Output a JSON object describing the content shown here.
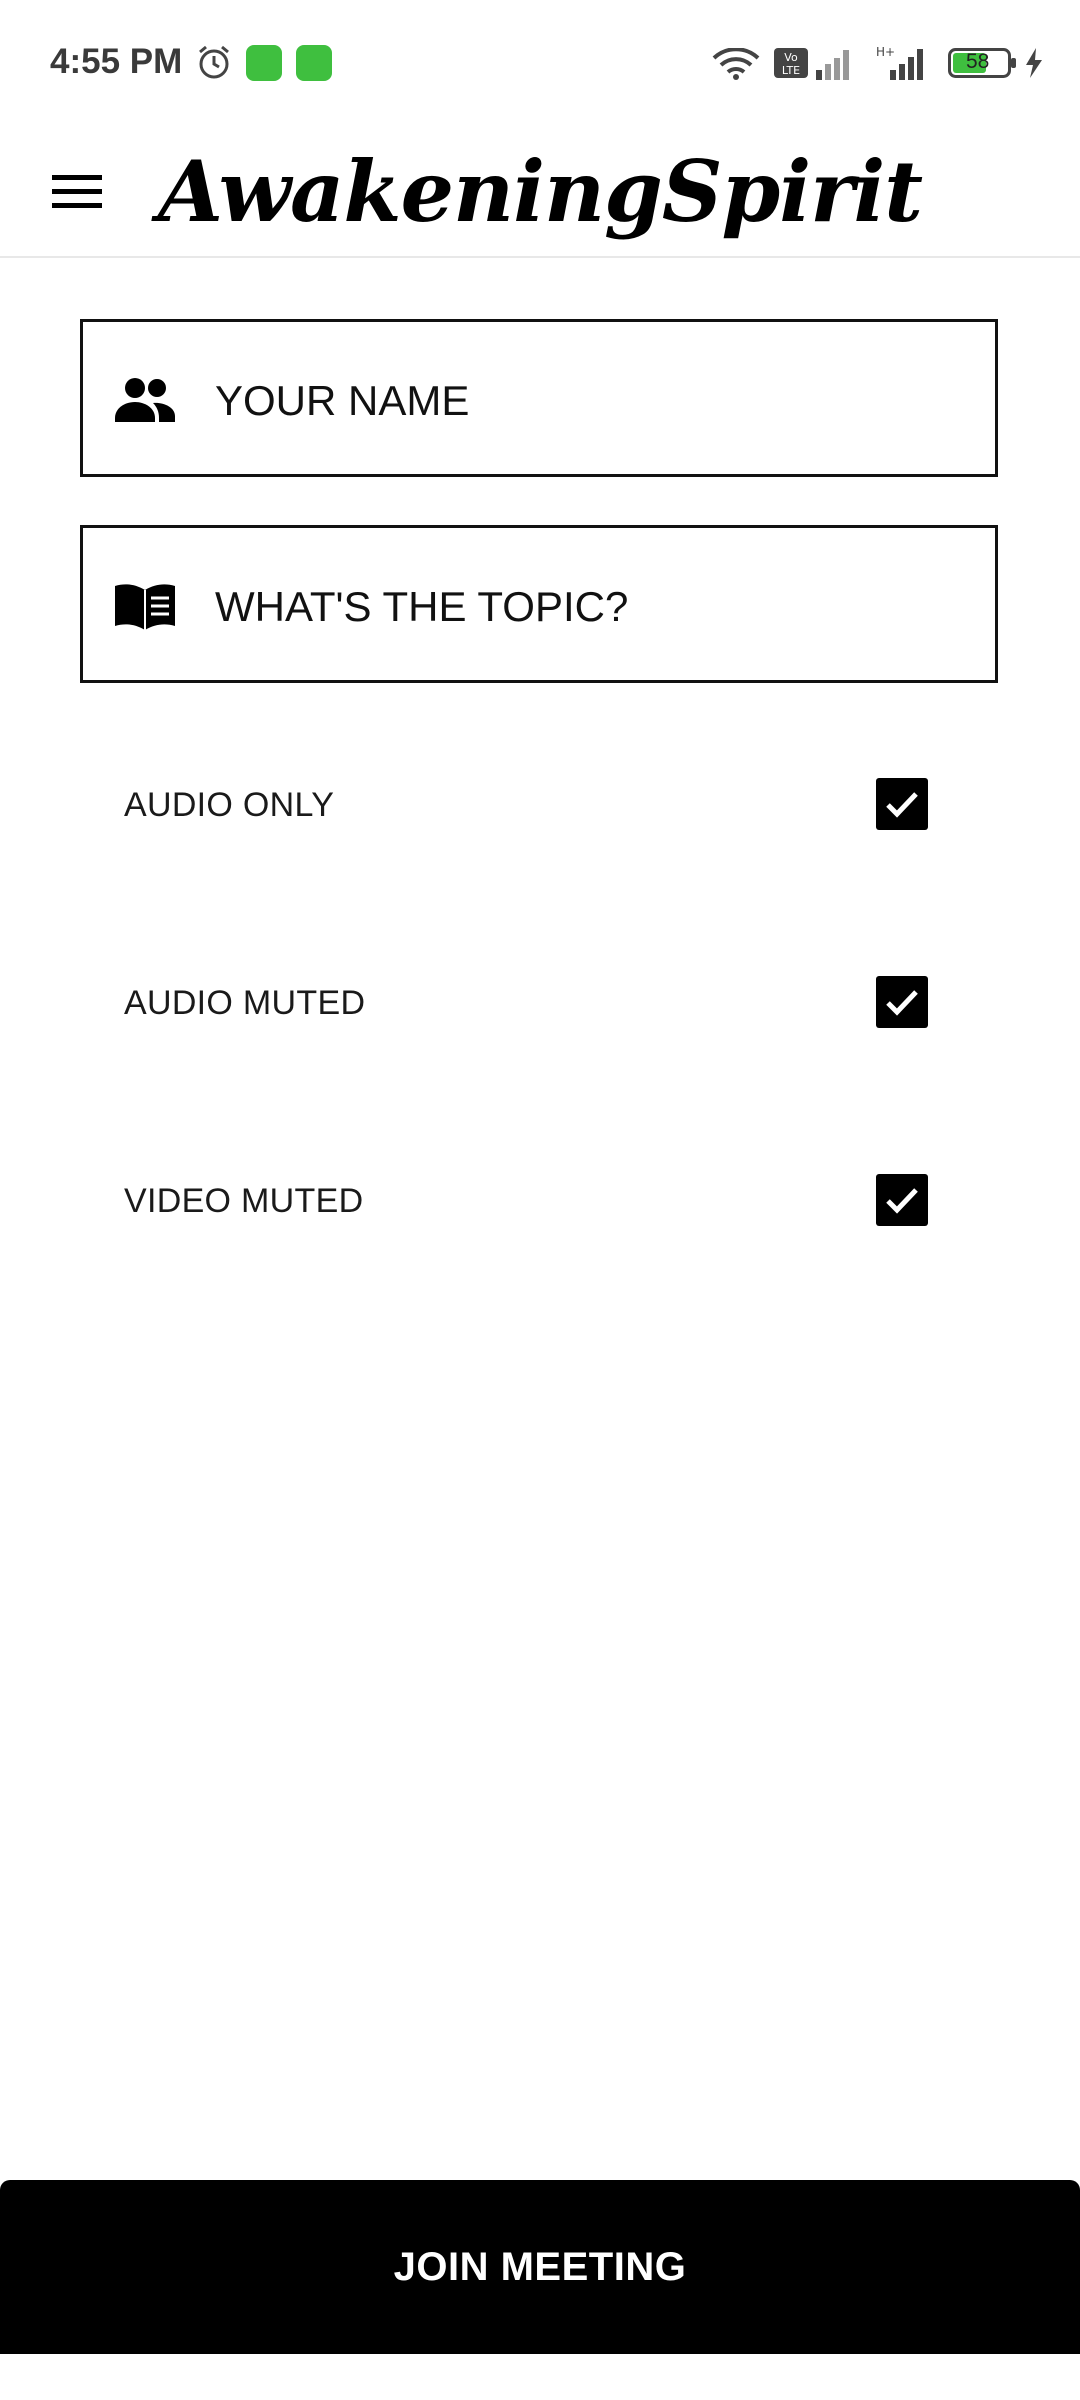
{
  "status_bar": {
    "time": "4:55 PM",
    "battery_level": "58",
    "icons": [
      "alarm-icon",
      "app-notification-icon",
      "app-notification-icon",
      "wifi-icon",
      "volte-icon",
      "signal-icon",
      "signal-icon",
      "battery-icon",
      "charging-icon"
    ],
    "accent_color": "#3fbf3f"
  },
  "header": {
    "title": "AwakeningSpirit",
    "menu_icon": "hamburger-menu-icon"
  },
  "form": {
    "name_field": {
      "placeholder": "YOUR NAME",
      "value": "",
      "icon": "people-icon"
    },
    "topic_field": {
      "placeholder": "WHAT'S THE TOPIC?",
      "value": "",
      "icon": "book-icon"
    }
  },
  "options": [
    {
      "label": "AUDIO ONLY",
      "checked": true
    },
    {
      "label": "AUDIO MUTED",
      "checked": true
    },
    {
      "label": "VIDEO MUTED",
      "checked": true
    }
  ],
  "actions": {
    "join_label": "JOIN MEETING"
  }
}
